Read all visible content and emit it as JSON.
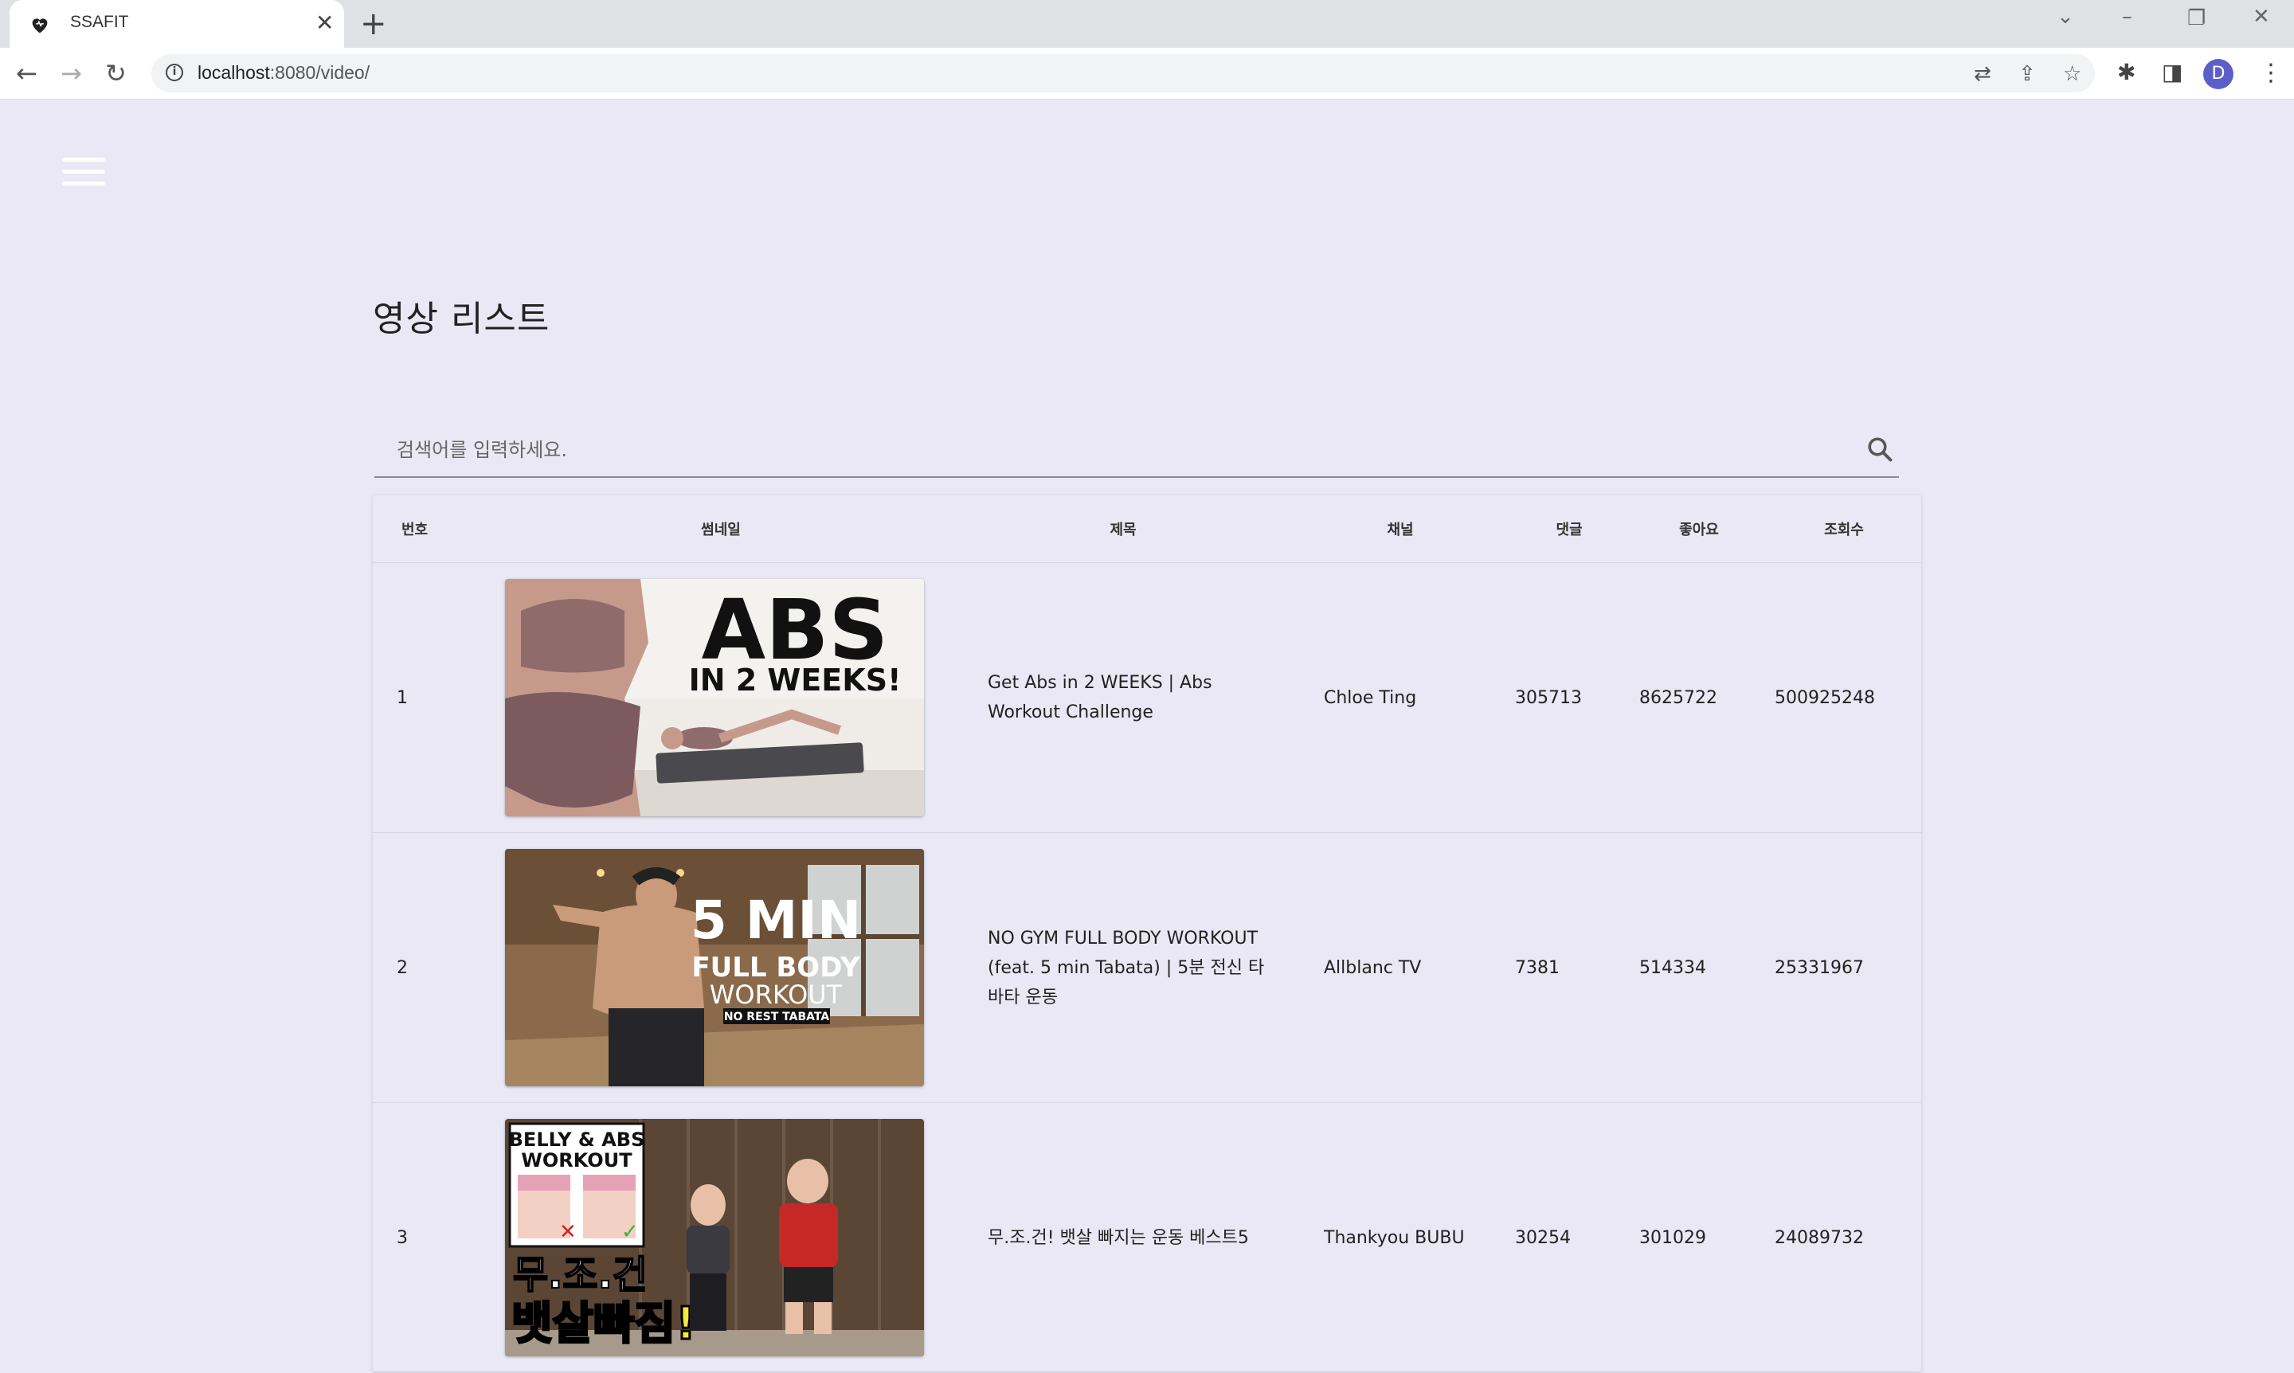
{
  "browser": {
    "tab_title": "SSAFIT",
    "url_host": "localhost",
    "url_rest": ":8080/video/",
    "profile_initial": "D"
  },
  "page": {
    "title": "영상 리스트",
    "search_placeholder": "검색어를 입력하세요."
  },
  "table": {
    "headers": [
      "번호",
      "썸네일",
      "제목",
      "채널",
      "댓글",
      "좋아요",
      "조회수"
    ],
    "rows": [
      {
        "no": "1",
        "title": "Get Abs in 2 WEEKS | Abs Workout Challenge",
        "channel": "Chloe Ting",
        "comments": "305713",
        "likes": "8625722",
        "views": "500925248",
        "thumb_text": [
          "ABS",
          "IN 2 WEEKS!"
        ]
      },
      {
        "no": "2",
        "title": "NO GYM FULL BODY WORKOUT (feat. 5 min Tabata) | 5분 전신 타바타 운동",
        "channel": "Allblanc TV",
        "comments": "7381",
        "likes": "514334",
        "views": "25331967",
        "thumb_text": [
          "5 MIN",
          "FULL BODY",
          "WORKOUT",
          "NO REST TABATA"
        ]
      },
      {
        "no": "3",
        "title": "무.조.건! 뱃살 빠지는 운동 베스트5",
        "channel": "Thankyou BUBU",
        "comments": "30254",
        "likes": "301029",
        "views": "24089732",
        "thumb_text": [
          "BELLY & ABS",
          "WORKOUT",
          "무.조.건",
          "뱃살빠짐!"
        ]
      }
    ]
  }
}
